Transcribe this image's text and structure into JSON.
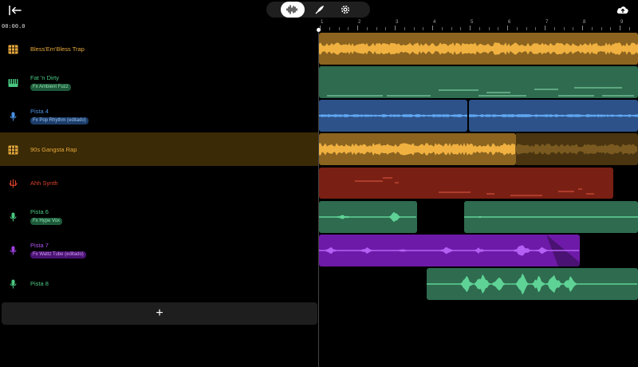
{
  "header": {
    "timecode": "00:00.0",
    "icons": {
      "exit": "exit-icon",
      "waveform": "waveform-icon",
      "effects": "rocket-icon",
      "settings": "gear-icon",
      "upload": "cloud-upload-icon"
    }
  },
  "ruler": {
    "labels": [
      "1",
      "2",
      "3",
      "4",
      "5",
      "6",
      "7",
      "8",
      "9"
    ]
  },
  "tracks": [
    {
      "name": "Bless'Em'Bless Trap",
      "icon": "drum-machine-icon",
      "color": "#e6a83c"
    },
    {
      "name": "Fat 'n Dirty",
      "fx": "Fx Ambient Fuzz",
      "icon": "keyboard-icon",
      "color": "#49c781"
    },
    {
      "name": "Pista 4",
      "fx": "Fx Pop Rhythm (editado)",
      "icon": "microphone-icon",
      "color": "#4a90e2"
    },
    {
      "name": "90s Gangsta Rap",
      "icon": "drum-machine-icon",
      "color": "#e6a83c"
    },
    {
      "name": "Ahh Synth",
      "icon": "synth-icon",
      "color": "#d9412b"
    },
    {
      "name": "Pista 6",
      "fx": "Fx Hype Vox",
      "icon": "microphone-icon",
      "color": "#49c781"
    },
    {
      "name": "Pista 7",
      "fx": "Fx Wattz Tube (editado)",
      "icon": "microphone-icon",
      "color": "#a040e0"
    },
    {
      "name": "Pista 8",
      "icon": "microphone-icon",
      "color": "#49c781"
    }
  ],
  "add_track": {
    "label": "+"
  },
  "colors": {
    "yellow": "#e6a83c",
    "green": "#2e6b4f",
    "blue": "#2d5289",
    "red": "#7a1f14",
    "purple": "#6e1aa8"
  }
}
